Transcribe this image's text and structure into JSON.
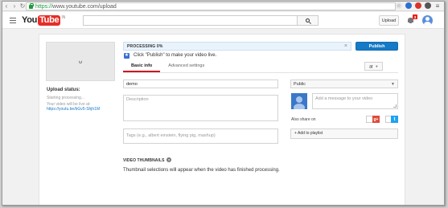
{
  "browser": {
    "url_scheme": "https://",
    "url_rest": "www.youtube.com/upload"
  },
  "header": {
    "logo_you": "You",
    "logo_tube": "Tube",
    "logo_country": "IN",
    "upload_label": "Upload",
    "notification_count": "3"
  },
  "left": {
    "upload_status_label": "Upload status:",
    "status_line_1": "Starting processing...",
    "status_line_2": "Your video will be live at:",
    "video_link": "https://youtu.be/bGv5-Shjh1M"
  },
  "processing": {
    "label": "PROCESSING 0%",
    "percent": 0,
    "close_glyph": "×",
    "publish_label": "Publish"
  },
  "hint": {
    "star_glyph": "★",
    "text": "Click \"Publish\" to make your video live."
  },
  "tabs": [
    {
      "label": "Basic info",
      "active": true
    },
    {
      "label": "Advanced settings",
      "active": false
    }
  ],
  "lang_button": {
    "glyph": "अ",
    "caret": "▼"
  },
  "form": {
    "title_value": "demo",
    "description_placeholder": "Description",
    "tags_placeholder": "Tags (e.g., albert einstein, flying pig, mashup)"
  },
  "privacy": {
    "selected": "Public",
    "caret": "▼"
  },
  "share": {
    "message_placeholder": "Add a message to your video",
    "also_share_label": "Also share on",
    "gplus_glyph": "g+",
    "twitter_glyph": "t"
  },
  "playlist": {
    "label": "+ Add to playlist"
  },
  "thumbnails": {
    "heading": "VIDEO THUMBNAILS",
    "help_glyph": "?",
    "text": "Thumbnail selections will appear when the video has finished processing."
  },
  "colors": {
    "accent": "#167ac6",
    "youtube_red": "#e52d27",
    "tab_underline": "#cc181e"
  }
}
